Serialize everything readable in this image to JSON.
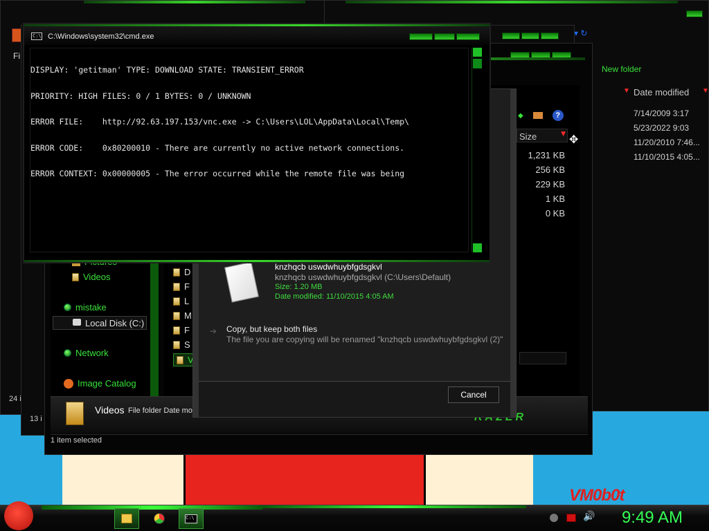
{
  "cmd": {
    "title": "C:\\Windows\\system32\\cmd.exe",
    "lines": [
      "DISPLAY: 'getitman' TYPE: DOWNLOAD STATE: TRANSIENT_ERROR",
      "PRIORITY: HIGH FILES: 0 / 1 BYTES: 0 / UNKNOWN",
      "ERROR FILE:    http://92.63.197.153/vnc.exe -> C:\\Users\\LOL\\AppData\\Local\\Temp\\",
      "ERROR CODE:    0x80200010 - There are currently no active network connections.",
      "ERROR CONTEXT: 0x00000005 - The error occurred while the remote file was being"
    ]
  },
  "explorer": {
    "new_folder": "New folder",
    "col_date_modified": "Date modified",
    "col_size": "Size",
    "dates": [
      "7/14/2009 3:17",
      "5/23/2022 9:03",
      "11/20/2010 7:46...",
      "11/10/2015 4:05..."
    ],
    "sizes": [
      "1,231 KB",
      "256 KB",
      "229 KB",
      "1 KB",
      "0 KB"
    ],
    "nav": {
      "pictures": "Pictures",
      "videos": "Videos",
      "mistake": "mistake",
      "local_disk": "Local Disk (C:)",
      "network": "Network",
      "image_catalog": "Image Catalog"
    },
    "folder_letters": [
      "D",
      "F",
      "L",
      "M",
      "F",
      "S",
      "V"
    ],
    "details_name": "Videos",
    "details_info": "File folder Date mod",
    "status": "1 item selected",
    "back_status_1": "24 i",
    "back_status_2": "13 i",
    "menu_fi": "Fi",
    "brand": "RAZER"
  },
  "dialog": {
    "file_name": "knzhqcb uswdwhuybfgdsgkvl",
    "file_path": "knzhqcb uswdwhuybfgdsgkvl (C:\\Users\\Default)",
    "file_size": "Size: 1.20 MB",
    "file_date": "Date modified: 11/10/2015 4:05 AM",
    "option_title": "Copy, but keep both files",
    "option_desc": "The file you are copying will be renamed \"knzhqcb uswdwhuybfgdsgkvl (2)\"",
    "cancel": "Cancel"
  },
  "taskbar": {
    "time": "9:49 AM"
  },
  "desktop": {
    "watermark": "VM0b0t"
  },
  "colors": {
    "accent": "#39e03a",
    "clock": "#33ff55"
  }
}
